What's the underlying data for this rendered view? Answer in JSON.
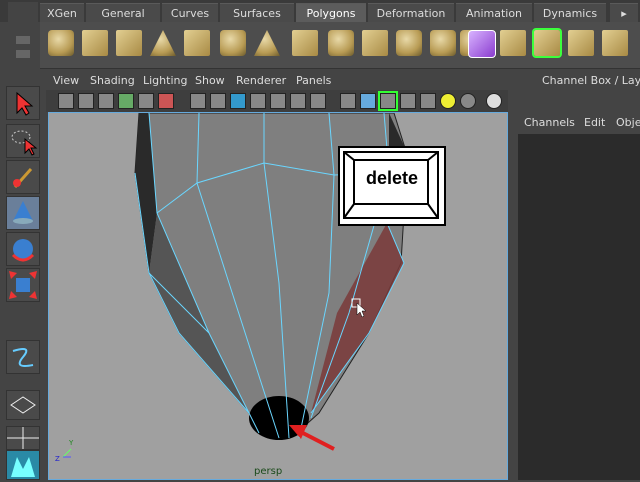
{
  "shelf": {
    "tabs": [
      "XGen",
      "General",
      "Curves",
      "Surfaces",
      "Polygons",
      "Deformation",
      "Animation",
      "Dynamics"
    ],
    "active_tab": "Polygons"
  },
  "viewport": {
    "menus": [
      "View",
      "Shading",
      "Lighting",
      "Show",
      "Renderer",
      "Panels"
    ],
    "camera_label": "persp",
    "axis_labels": [
      "Y",
      "Z"
    ],
    "bg_color": "#a0a0a0",
    "selection_color": "#6ad6ff"
  },
  "overlay": {
    "key_label": "delete"
  },
  "channel_box": {
    "title": "Channel Box / Layer E",
    "menus": [
      "Channels",
      "Edit",
      "Obje"
    ]
  },
  "colors": {
    "highlight_face": "#7a3a3a",
    "arrow": "#e02020"
  }
}
